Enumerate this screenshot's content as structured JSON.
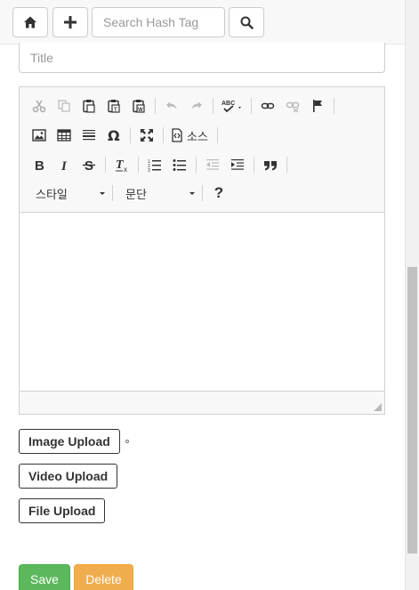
{
  "topbar": {
    "home_icon": "home-icon",
    "add_icon": "plus-icon",
    "search_placeholder": "Search Hash Tag",
    "search_icon": "search-icon"
  },
  "form": {
    "title_placeholder": "Title"
  },
  "editor": {
    "toolbar_row1": [
      "cut",
      "copy",
      "paste",
      "paste-as-text",
      "paste-from-word",
      "undo",
      "redo",
      "spellcheck",
      "link",
      "unlink",
      "anchor"
    ],
    "toolbar_row2": [
      "image",
      "table",
      "horizontal-line",
      "special-char",
      "maximize",
      "source"
    ],
    "source_label": "소스",
    "toolbar_row3": [
      "bold",
      "italic",
      "strike",
      "remove-format",
      "numbered-list",
      "bulleted-list",
      "outdent",
      "indent",
      "blockquote"
    ],
    "style_label": "스타일",
    "format_label": "문단",
    "help_label": "?"
  },
  "uploads": {
    "image": "Image Upload",
    "video": "Video Upload",
    "file": "File Upload"
  },
  "actions": {
    "save": "Save",
    "delete": "Delete",
    "save_color": "#5cb85c",
    "delete_color": "#f0ad4e"
  }
}
